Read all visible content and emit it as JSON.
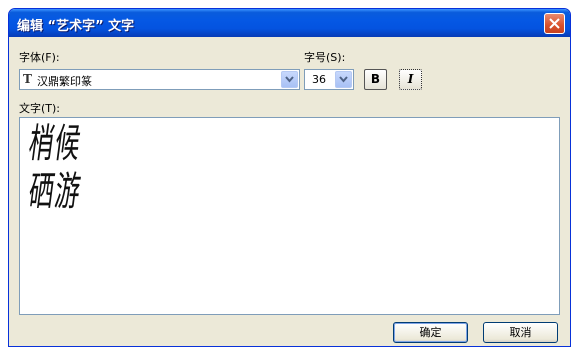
{
  "dialog": {
    "title": "编辑 “艺术字” 文字",
    "close_icon": "close-icon"
  },
  "font": {
    "label": "字体(F):",
    "value": "汉鼎繁印篆",
    "icon": "truetype-font-icon"
  },
  "size": {
    "label": "字号(S):",
    "value": "36"
  },
  "format": {
    "bold_label": "B",
    "italic_label": "I"
  },
  "text": {
    "label": "文字(T):",
    "lines": [
      "梢候",
      "硒游"
    ]
  },
  "buttons": {
    "ok": "确定",
    "cancel": "取消"
  },
  "colors": {
    "titlebar": "#0558e4",
    "dialog_bg": "#ece9d8",
    "close_button": "#d9512c",
    "input_border": "#7f9db9"
  }
}
